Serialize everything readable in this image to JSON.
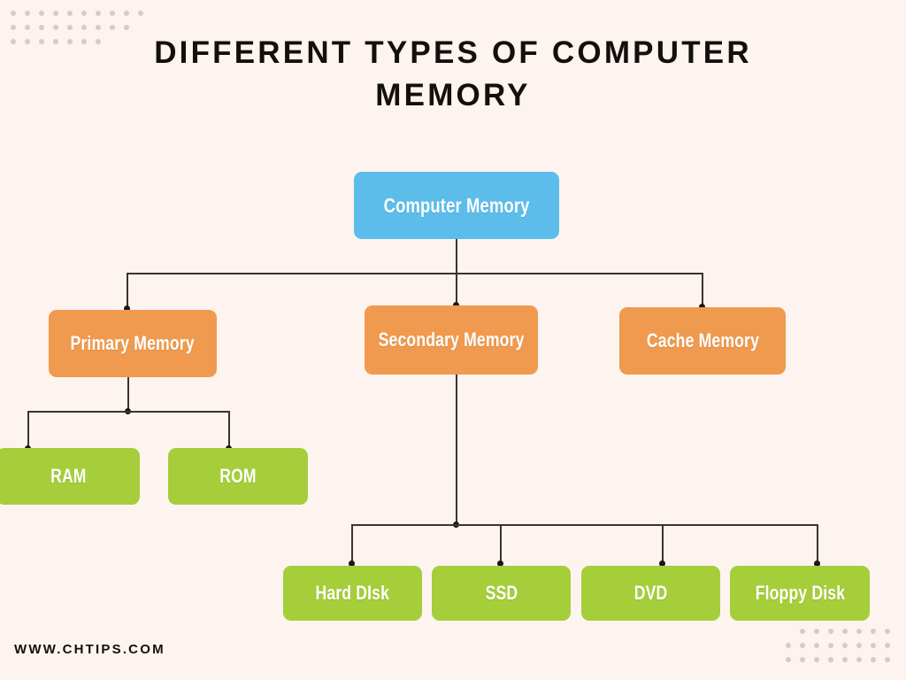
{
  "page": {
    "title": "DIFFERENT TYPES OF COMPUTER MEMORY",
    "footer_url": "WWW.CHTIPS.COM",
    "background_color": "#FDF3EF",
    "title_color": "#120F0D",
    "dot_pattern_color": "#DCC9C4",
    "connector_color": "#3A3330"
  },
  "colors": {
    "root": "#5CBDEB",
    "level1": "#EF9A4E",
    "level2": "#A5CE3A",
    "node_text": "#FFFFFF"
  },
  "chart_data": {
    "type": "diagram",
    "diagram_kind": "tree",
    "title": "DIFFERENT TYPES OF COMPUTER MEMORY",
    "root": {
      "label": "Computer Memory",
      "color": "#5CBDEB",
      "children": [
        {
          "label": "Primary Memory",
          "color": "#EF9A4E",
          "children": [
            {
              "label": "RAM",
              "color": "#A5CE3A",
              "children": []
            },
            {
              "label": "ROM",
              "color": "#A5CE3A",
              "children": []
            }
          ]
        },
        {
          "label": "Secondary Memory",
          "color": "#EF9A4E",
          "children": [
            {
              "label": "Hard DIsk",
              "color": "#A5CE3A",
              "children": []
            },
            {
              "label": "SSD",
              "color": "#A5CE3A",
              "children": []
            },
            {
              "label": "DVD",
              "color": "#A5CE3A",
              "children": []
            },
            {
              "label": "Floppy Disk",
              "color": "#A5CE3A",
              "children": []
            }
          ]
        },
        {
          "label": "Cache Memory",
          "color": "#EF9A4E",
          "children": []
        }
      ]
    }
  },
  "nodes": {
    "root": {
      "label": "Computer Memory"
    },
    "primary": {
      "label": "Primary Memory"
    },
    "secondary": {
      "label": "Secondary Memory"
    },
    "cache": {
      "label": "Cache Memory"
    },
    "ram": {
      "label": "RAM"
    },
    "rom": {
      "label": "ROM"
    },
    "hard_disk": {
      "label": "Hard DIsk"
    },
    "ssd": {
      "label": "SSD"
    },
    "dvd": {
      "label": "DVD"
    },
    "floppy_disk": {
      "label": "Floppy Disk"
    }
  },
  "decorations": {
    "top_left_dots": {
      "name": "dot-grid-top-left",
      "rows": [
        10,
        9,
        7
      ]
    },
    "bottom_right_dots": {
      "name": "dot-grid-bottom-right",
      "rows": [
        7,
        8,
        8
      ]
    }
  }
}
